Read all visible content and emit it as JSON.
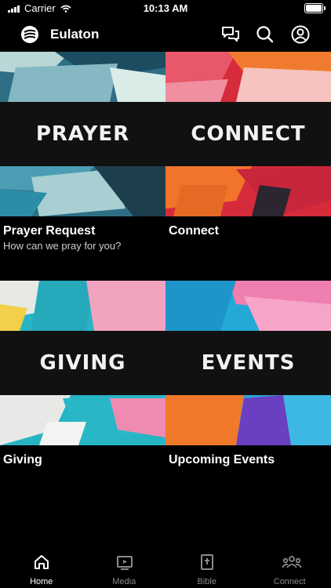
{
  "status": {
    "carrier": "Carrier",
    "time": "10:13 AM"
  },
  "header": {
    "title": "Eulaton"
  },
  "tiles": [
    {
      "band": "PRAYER",
      "title": "Prayer Request",
      "subtitle": "How can we pray for you?"
    },
    {
      "band": "CONNECT",
      "title": "Connect",
      "subtitle": ""
    },
    {
      "band": "GIVING",
      "title": "Giving",
      "subtitle": ""
    },
    {
      "band": "EVENTS",
      "title": "Upcoming Events",
      "subtitle": ""
    }
  ],
  "tabs": [
    {
      "label": "Home",
      "icon": "home-icon"
    },
    {
      "label": "Media",
      "icon": "play-icon"
    },
    {
      "label": "Bible",
      "icon": "bible-icon"
    },
    {
      "label": "Connect",
      "icon": "people-icon"
    }
  ],
  "colors": {
    "background": "#000000",
    "inactive_tab": "#8a8a8a",
    "active_tab": "#ffffff"
  }
}
